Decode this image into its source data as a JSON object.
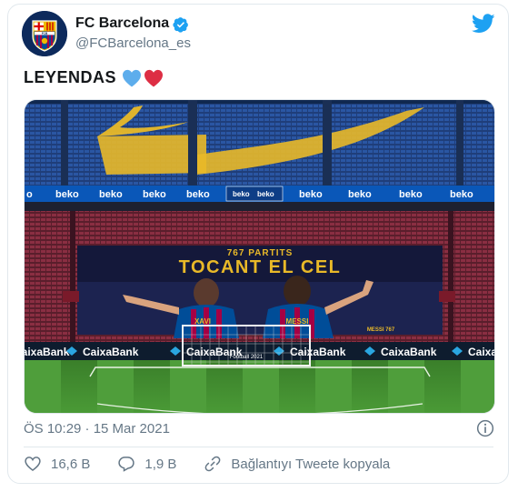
{
  "account": {
    "name": "FC Barcelona",
    "handle": "@FCBarcelona_es",
    "avatar_text": "FCB"
  },
  "tweet": {
    "text": "LEYENDAS",
    "emojis": [
      "blue-heart",
      "red-heart"
    ]
  },
  "media": {
    "banner_top": "767 PARTITS",
    "banner_main": "TOCANT EL CEL",
    "player_left": "XAVI",
    "player_right": "MESSI",
    "board_text": "MESSI 767",
    "sponsor_upper": "beko",
    "sponsor_lower": "CaixaBank",
    "goal_text": "Football 2021"
  },
  "timestamp": "ÖS 10:29 · 15 Mar 2021",
  "actions": {
    "likes": "16,6 B",
    "replies": "1,9 B",
    "copy_link": "Bağlantıyı Tweete kopyala"
  },
  "colors": {
    "twitter_blue": "#1da1f2",
    "secondary_text": "#657786",
    "barca_blue": "#004d98",
    "barca_red": "#a50044",
    "pitch_green": "#3d8b2e"
  },
  "icons": {
    "verified": "verified-badge-icon",
    "bird": "twitter-bird-icon",
    "info": "info-icon",
    "like": "heart-icon",
    "reply": "reply-bubble-icon",
    "link": "link-icon"
  }
}
